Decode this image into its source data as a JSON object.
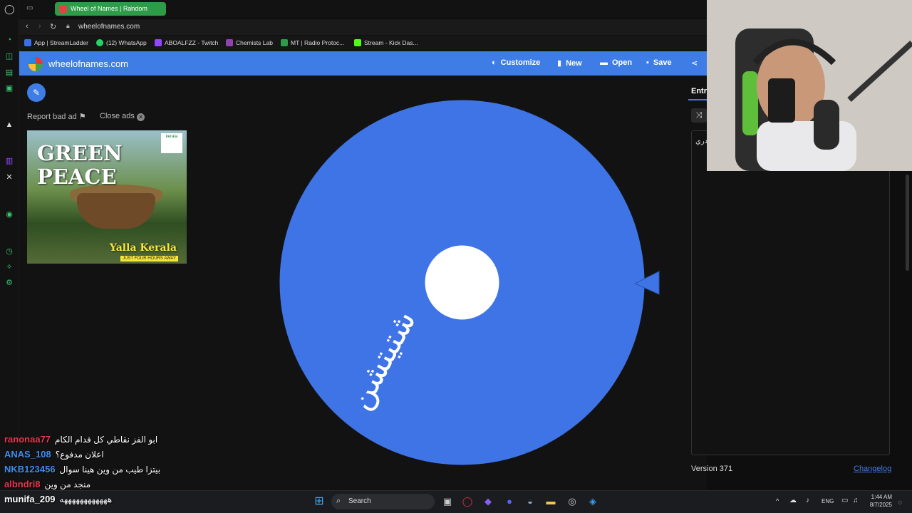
{
  "browser": {
    "tab_title": "Wheel of Names | Random",
    "new_tab_icon": "+",
    "address": "wheelofnames.com",
    "bookmarks": [
      {
        "label": "App | StreamLadder",
        "color": "#3b6ee8"
      },
      {
        "label": "(12) WhatsApp",
        "color": "#25d366"
      },
      {
        "label": "ABOALFZZ - Twitch",
        "color": "#9146ff"
      },
      {
        "label": "Chemists Lab",
        "color": "#8e44ad"
      },
      {
        "label": "MT | Radio Protoc...",
        "color": "#2e9b49"
      },
      {
        "label": "Stream - Kick Das...",
        "color": "#53fc18"
      }
    ]
  },
  "site": {
    "title": "wheelofnames.com",
    "nav": [
      {
        "label": "Customize",
        "icon": "palette-icon"
      },
      {
        "label": "New",
        "icon": "file-icon"
      },
      {
        "label": "Open",
        "icon": "folder-icon"
      },
      {
        "label": "Save",
        "icon": "save-icon"
      }
    ],
    "accent": "#3f7de6",
    "report_ad": "Report bad ad",
    "close_ads": "Close ads"
  },
  "ad": {
    "headline": "GREEN PEACE",
    "tagline": "Yalla Kerala",
    "subline": "JUST FOUR HOURS AWAY",
    "badge": "kerala"
  },
  "wheel": {
    "color": "#3f74e6",
    "entry_label": "شتيتشن"
  },
  "entries_panel": {
    "tab_label": "Entri",
    "entries_text": "دري",
    "version": "Version 371",
    "changelog": "Changelog"
  },
  "chat": [
    {
      "user": "ranonaa77",
      "color": "#e8384f",
      "msg": "ابو الفز نقاطي كل قدام الكام"
    },
    {
      "user": "ANAS_108",
      "color": "#3f8ef0",
      "msg": "اعلان مدفوع؟"
    },
    {
      "user": "NKB123456",
      "color": "#3f8ef0",
      "msg": "بيتزا طيب من وين هينا سوال"
    },
    {
      "user": "albndri8",
      "color": "#e8384f",
      "msg": "منجد من وين"
    },
    {
      "user": "munifa_209",
      "color": "#ffffff",
      "msg": "ههههههههههههه"
    }
  ],
  "taskbar": {
    "search": "Search",
    "lang": "ENG",
    "time": "1:44 AM",
    "date": "8/7/2025"
  }
}
